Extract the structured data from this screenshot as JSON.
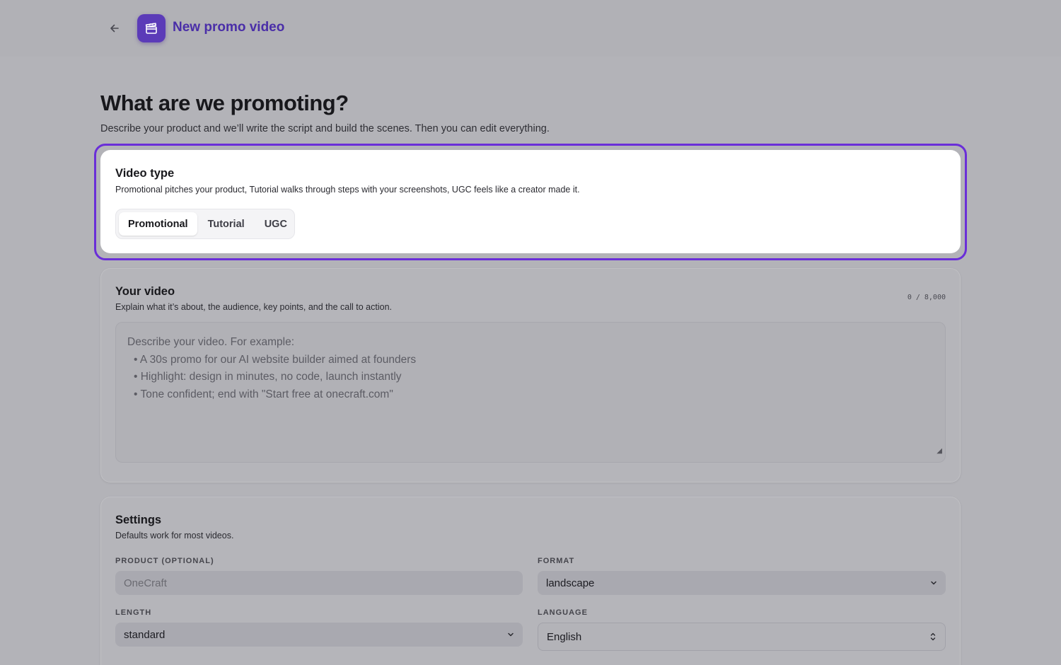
{
  "header": {
    "title": "New promo video",
    "back_icon": "arrow-left-icon",
    "app_icon": "clapperboard-icon",
    "accent": "#5b3bb8"
  },
  "page": {
    "heading": "What are we promoting?",
    "subheading": "Describe your product and we’ll write the script and build the scenes. Then you can edit everything."
  },
  "video_type": {
    "title": "Video type",
    "description": "Promotional pitches your product, Tutorial walks through steps with your screenshots, UGC feels like a creator made it.",
    "options": [
      {
        "label": "Promotional",
        "selected": true
      },
      {
        "label": "Tutorial",
        "selected": false
      },
      {
        "label": "UGC",
        "selected": false
      }
    ],
    "highlight_color": "#6a2ed8"
  },
  "your_video": {
    "title": "Your video",
    "description": "Explain what it’s about, the audience, key points, and the call to action.",
    "counter": "0 / 8,000",
    "value": "",
    "placeholder_lines": [
      "Describe your video. For example:",
      "",
      "• A 30s promo for our AI website builder aimed at founders",
      "• Highlight: design in minutes, no code, launch instantly",
      "• Tone confident; end with \"Start free at onecraft.com\""
    ]
  },
  "settings": {
    "title": "Settings",
    "description": "Defaults work for most videos.",
    "product": {
      "label": "PRODUCT (OPTIONAL)",
      "placeholder": "OneCraft",
      "value": ""
    },
    "format": {
      "label": "FORMAT",
      "value": "landscape"
    },
    "length": {
      "label": "LENGTH",
      "value": "standard"
    },
    "language": {
      "label": "LANGUAGE",
      "value": "English"
    }
  }
}
